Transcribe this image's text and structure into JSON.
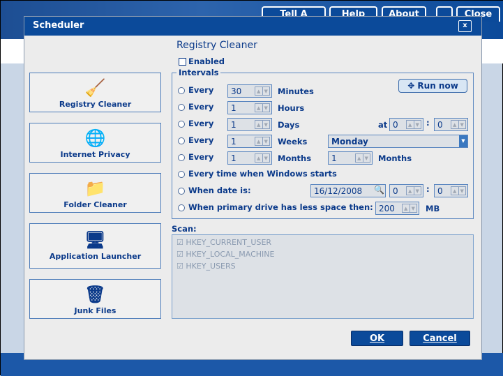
{
  "top_buttons": [
    "Tell A Friend",
    "Help",
    "About",
    "Close"
  ],
  "dialog": {
    "title": "Scheduler",
    "close_label": "x"
  },
  "sidebar": {
    "items": [
      {
        "label": "Registry Cleaner",
        "icon": "registry-cleaner-icon",
        "glyph": "🧹"
      },
      {
        "label": "Internet Privacy",
        "icon": "internet-privacy-icon",
        "glyph": "🌐"
      },
      {
        "label": "Folder Cleaner",
        "icon": "folder-cleaner-icon",
        "glyph": "📁"
      },
      {
        "label": "Application Launcher",
        "icon": "application-launcher-icon",
        "glyph": "🖥"
      },
      {
        "label": "Junk Files",
        "icon": "junk-files-icon",
        "glyph": "🗑"
      }
    ]
  },
  "main": {
    "title": "Registry Cleaner",
    "enabled_label": "Enabled",
    "enabled": false,
    "intervals_label": "Intervals",
    "run_now": "Run now",
    "every": "Every",
    "rows": [
      {
        "value": "30",
        "unit": "Minutes"
      },
      {
        "value": "1",
        "unit": "Hours"
      },
      {
        "value": "1",
        "unit": "Days"
      },
      {
        "value": "1",
        "unit": "Weeks"
      },
      {
        "value": "1",
        "unit": "Months"
      }
    ],
    "at_label": "at",
    "at_hour": "0",
    "at_min": "0",
    "colon": ":",
    "weekday": "Monday",
    "months_value": "1",
    "months_label": "Months",
    "windows_start": "Every time when Windows starts",
    "when_date": "When date is:",
    "date": "16/12/2008",
    "date_hour": "0",
    "date_min": "0",
    "drive_space": "When primary drive has less space then:",
    "space_value": "200",
    "space_unit": "MB",
    "scan_label": "Scan:",
    "scan_items": [
      "HKEY_CURRENT_USER",
      "HKEY_LOCAL_MACHINE",
      "HKEY_USERS"
    ]
  },
  "footer": {
    "ok": "OK",
    "cancel": "Cancel"
  }
}
